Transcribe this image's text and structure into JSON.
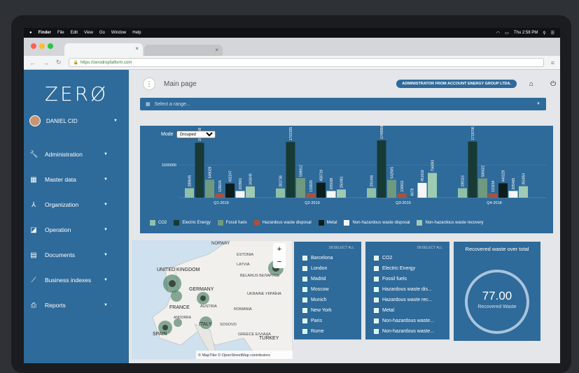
{
  "mac": {
    "apple": "",
    "app": "Finder",
    "menus": [
      "File",
      "Edit",
      "View",
      "Go",
      "Window",
      "Help"
    ],
    "clock": "Thu 2:58 PM"
  },
  "browser": {
    "url": "https://zerodropfatform.com"
  },
  "sidebar": {
    "logo": "ZERØ",
    "user": "DANIEL CID",
    "items": [
      {
        "label": "Administration",
        "icon": "wrench-icon"
      },
      {
        "label": "Master data",
        "icon": "grid-icon"
      },
      {
        "label": "Organization",
        "icon": "org-icon"
      },
      {
        "label": "Operation",
        "icon": "operation-icon"
      },
      {
        "label": "Documents",
        "icon": "document-icon"
      },
      {
        "label": "Business indexes",
        "icon": "trend-icon"
      },
      {
        "label": "Reports",
        "icon": "printer-icon"
      }
    ]
  },
  "header": {
    "title": "Main page",
    "admin": "ADMINISTRATOR FROM ACCOUNT ENERGY GROUP LTDA."
  },
  "range": {
    "placeholder": "Select a range..."
  },
  "chart": {
    "mode_label": "Mode",
    "mode": "Grouped"
  },
  "chart_data": {
    "type": "bar",
    "categories": [
      "Q1-2019",
      "Q2-2019",
      "Q3-2019",
      "Q4-2018"
    ],
    "ylabel_tick": "1000000",
    "series": [
      {
        "name": "CO2",
        "color": "#8fc1a9",
        "values": [
          289645,
          281736,
          291446,
          289116
        ]
      },
      {
        "name": "Electric Energy",
        "color": "#173a35",
        "values": [
          1680798,
          1702155,
          1749866,
          1715706
        ]
      },
      {
        "name": "Fossil fuels",
        "color": "#6f9a80",
        "values": [
          549029,
          598912,
          542565,
          586622
        ]
      },
      {
        "name": "Hazardous waste disposal",
        "color": "#a8523c",
        "values": [
          129624,
          133629,
          136611,
          131154
        ]
      },
      {
        "name": "Metal",
        "color": "#0c1e1c",
        "values": [
          432247,
          458719,
          6679,
          440129
        ]
      },
      {
        "name": "Non-hazardous waste disposal",
        "color": "#f4f6f7",
        "values": [
          203901,
          205038,
          451618,
          205465
        ]
      },
      {
        "name": "Non-hazardous waste recovery",
        "color": "#9fcab3",
        "values": [
          343645,
          250481,
          756093,
          350054
        ]
      }
    ],
    "data_labels_partial": [
      "6782",
      "6862"
    ]
  },
  "map": {
    "labels": [
      "NORWAY",
      "ESTONIA",
      "LATVIA",
      "UNITED KINGDOM",
      "BELARUS БЕЛАРУСЬ",
      "GERMANY",
      "UKRAINE УКРАЇНА",
      "FRANCE",
      "AUSTRIA",
      "ROMANIA",
      "ANDORRA",
      "ITALY",
      "SOSOVO",
      "SPAIN",
      "GREECE ΕΛΛΑΔΑ",
      "TURKEY"
    ],
    "attribution": "© MapTiler © OpenStreetMap contributors",
    "zoom_in": "+",
    "zoom_out": "−"
  },
  "cities": {
    "deselect": "DESELECT ALL",
    "items": [
      "Barcelona",
      "London",
      "Madrid",
      "Moscow",
      "Munich",
      "New York",
      "Paris",
      "Rome"
    ]
  },
  "types": {
    "deselect": "DESELECT ALL",
    "items": [
      "CO2",
      "Electric Energy",
      "Fossil fuels",
      "Hazardous waste dis...",
      "Hazardous waste rec...",
      "Metal",
      "Non-hazardous waste...",
      "Non-hazardous waste..."
    ]
  },
  "kpi": {
    "title": "Recovered waste over total",
    "value": "77.00",
    "label": "Recovered Waste",
    "fraction": 0.77
  }
}
